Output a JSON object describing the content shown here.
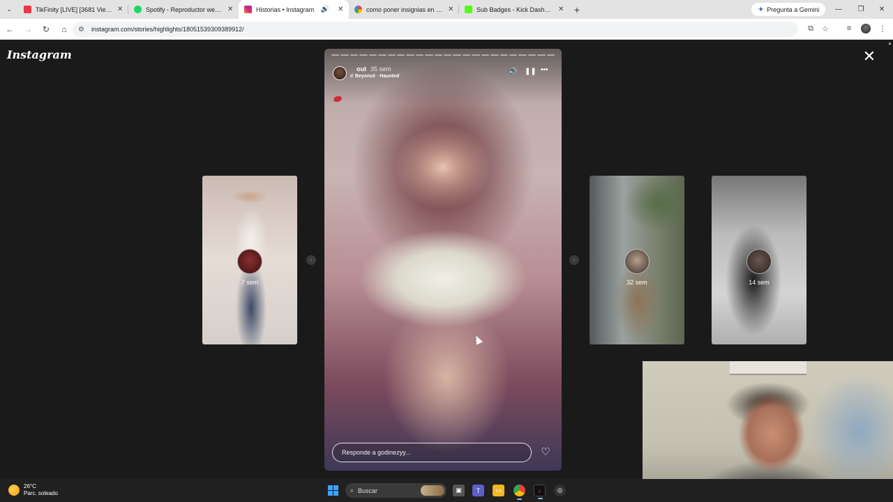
{
  "browser": {
    "tabs": [
      {
        "label": "TikFinity [LIVE] [3681 Viewers]",
        "favicon_color": "#e8364a",
        "active": false
      },
      {
        "label": "Spotify - Reproductor web: música",
        "favicon_color": "#1ed760",
        "active": false
      },
      {
        "label": "Historias • Instagram",
        "favicon_color": "#d62976",
        "active": true
      },
      {
        "label": "como poner insignias en kick - ",
        "favicon_color": "#4285f4",
        "active": false
      },
      {
        "label": "Sub Badges - Kick Dashboard",
        "favicon_color": "#53fc18",
        "active": false
      }
    ],
    "gemini_label": "Pregunta a Gemini",
    "url": "instagram.com/stories/highlights/18051539309389912/"
  },
  "instagram": {
    "logo": "Instagram",
    "story": {
      "username": "out",
      "time_ago": "35 sem",
      "song": "Beyoncé · Haunted",
      "reply_placeholder": "Responde a godinezyy...",
      "segments": 24
    },
    "previews": [
      {
        "time_ago": "7 sem"
      },
      {
        "time_ago": "32 sem"
      },
      {
        "time_ago": "14 sem"
      }
    ]
  },
  "taskbar": {
    "weather_temp": "26°C",
    "weather_desc": "Parc. soleado",
    "search_placeholder": "Buscar"
  }
}
